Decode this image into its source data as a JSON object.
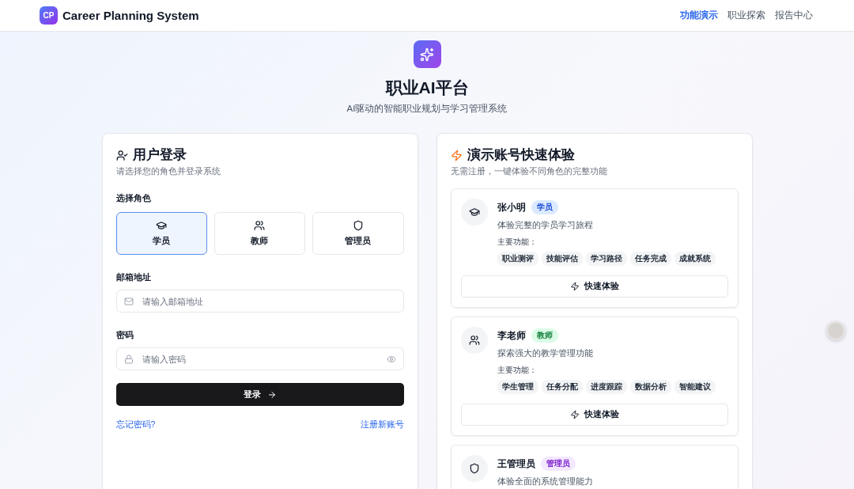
{
  "header": {
    "logo": "CP",
    "title": "Career Planning System",
    "nav": [
      {
        "label": "功能演示",
        "selected": true
      },
      {
        "label": "职业探索",
        "selected": false
      },
      {
        "label": "报告中心",
        "selected": false
      }
    ]
  },
  "hero": {
    "title": "职业AI平台",
    "subtitle": "AI驱动的智能职业规划与学习管理系统"
  },
  "login": {
    "title": "用户登录",
    "subtitle": "请选择您的角色并登录系统",
    "role_label": "选择角色",
    "roles": [
      {
        "kind": "student",
        "label": "学员",
        "selected": true
      },
      {
        "kind": "teacher",
        "label": "教师",
        "selected": false
      },
      {
        "kind": "admin",
        "label": "管理员",
        "selected": false
      }
    ],
    "email": {
      "label": "邮箱地址",
      "placeholder": "请输入邮箱地址"
    },
    "password": {
      "label": "密码",
      "placeholder": "请输入密码"
    },
    "submit": "登录",
    "forgot": "忘记密码?",
    "register": "注册新账号"
  },
  "demo": {
    "title": "演示账号快速体验",
    "subtitle": "无需注册，一键体验不同角色的完整功能",
    "accounts": [
      {
        "kind": "student",
        "name": "张小明",
        "badge": "学员",
        "color": "#dbeafe",
        "description": "体验完整的学员学习旅程",
        "features_label": "主要功能：",
        "features": [
          "职业测评",
          "技能评估",
          "学习路径",
          "任务完成",
          "成就系统"
        ],
        "button": "快速体验"
      },
      {
        "kind": "teacher",
        "name": "李老师",
        "badge": "教师",
        "color": "#dcfce7",
        "description": "探索强大的教学管理功能",
        "features_label": "主要功能：",
        "features": [
          "学生管理",
          "任务分配",
          "进度跟踪",
          "数据分析",
          "智能建议"
        ],
        "button": "快速体验"
      },
      {
        "kind": "admin",
        "name": "王管理员",
        "badge": "管理员",
        "color": "#f3e8ff",
        "description": "体验全面的系统管理能力"
      }
    ]
  }
}
